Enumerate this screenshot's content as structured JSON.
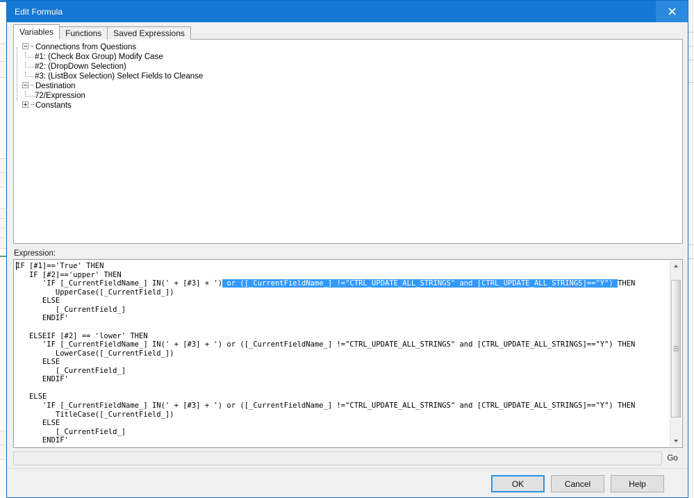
{
  "window": {
    "title": "Edit Formula",
    "close_label": "x"
  },
  "tabs": [
    {
      "label": "Variables",
      "active": true
    },
    {
      "label": "Functions",
      "active": false
    },
    {
      "label": "Saved Expressions",
      "active": false
    }
  ],
  "tree": {
    "groups": [
      {
        "label": "Connections from Questions",
        "expanded": true,
        "children": [
          "#1: (Check Box Group) Modify Case",
          "#2: (DropDown Selection)",
          "#3: (ListBox Selection) Select Fields to Cleanse"
        ]
      },
      {
        "label": "Destination",
        "expanded": true,
        "children": [
          "72/Expression"
        ]
      },
      {
        "label": "Constants",
        "expanded": false,
        "children": []
      }
    ]
  },
  "expression": {
    "label": "Expression:",
    "lines": [
      {
        "text": "IF [#1]=='True' THEN"
      },
      {
        "text": "   IF [#2]=='upper' THEN"
      },
      {
        "pre": "      'IF [_CurrentFieldName_] IN(' + [#3] + ')",
        "selected": " or ([_CurrentFieldName_] !=\"CTRL_UPDATE_ALL_STRINGS\" and [CTRL_UPDATE_ALL_STRINGS]==\"Y\") ",
        "post": "THEN"
      },
      {
        "text": "         UpperCase([_CurrentField_])"
      },
      {
        "text": "      ELSE"
      },
      {
        "text": "         [_CurrentField_]"
      },
      {
        "text": "      ENDIF'"
      },
      {
        "text": ""
      },
      {
        "text": "   ELSEIF [#2] == 'lower' THEN"
      },
      {
        "text": "      'IF [_CurrentFieldName_] IN(' + [#3] + ') or ([_CurrentFieldName_] !=\"CTRL_UPDATE_ALL_STRINGS\" and [CTRL_UPDATE_ALL_STRINGS]==\"Y\") THEN"
      },
      {
        "text": "         LowerCase([_CurrentField_])"
      },
      {
        "text": "      ELSE"
      },
      {
        "text": "         [_CurrentField_]"
      },
      {
        "text": "      ENDIF'"
      },
      {
        "text": ""
      },
      {
        "text": "   ELSE"
      },
      {
        "text": "      'IF [_CurrentFieldName_] IN(' + [#3] + ') or ([_CurrentFieldName_] !=\"CTRL_UPDATE_ALL_STRINGS\" and [CTRL_UPDATE_ALL_STRINGS]==\"Y\") THEN"
      },
      {
        "text": "         TitleCase([_CurrentField_])"
      },
      {
        "text": "      ELSE"
      },
      {
        "text": "         [_CurrentField_]"
      },
      {
        "text": "      ENDIF'"
      }
    ],
    "scrollbar": {
      "thumb_top_pct": 5,
      "thumb_height_pct": 84
    }
  },
  "gobar": {
    "value": "",
    "placeholder": "",
    "go_label": "Go"
  },
  "footer": {
    "ok_label": "OK",
    "cancel_label": "Cancel",
    "help_label": "Help"
  },
  "colors": {
    "titlebar": "#1379d5",
    "selection": "#3399ff",
    "focus_border": "#2a93e0"
  }
}
